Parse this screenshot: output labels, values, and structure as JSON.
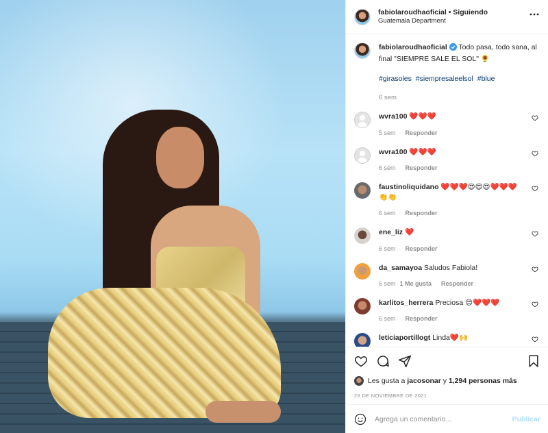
{
  "post": {
    "author": "fabiolaroudhaoficial",
    "follow_status": "Siguiendo",
    "separator": "•",
    "location": "Guatemala Department",
    "more_icon": "more-horizontal-icon"
  },
  "caption": {
    "author": "fabiolaroudhaoficial",
    "verified_icon": "verified-badge-icon",
    "text": "Todo pasa, todo sana, al final \"SIEMPRE SALE EL SOL\" 🌻",
    "hashtags": [
      "#girasoles",
      "#siempresaleelsol",
      "#blue"
    ],
    "time": "6 sem"
  },
  "comments": [
    {
      "user": "wvra100",
      "text": "❤️❤️❤️",
      "time": "5 sem",
      "reply": "Responder"
    },
    {
      "user": "wvra100",
      "text": "❤️❤️❤️",
      "time": "6 sem",
      "reply": "Responder"
    },
    {
      "user": "faustinoliquidano",
      "text": "❤️❤️❤️😍😍😍❤️❤️❤️👏👏",
      "time": "6 sem",
      "reply": "Responder"
    },
    {
      "user": "ene_liz",
      "text": "❤️",
      "time": "6 sem",
      "reply": "Responder"
    },
    {
      "user": "da_samayoa",
      "text": "Saludos Fabiola!",
      "time": "6 sem",
      "likes": "1 Me gusta",
      "reply": "Responder"
    },
    {
      "user": "karlitos_herrera",
      "text": "Preciosa 😍❤️❤️❤️",
      "time": "6 sem",
      "reply": "Responder"
    },
    {
      "user": "leticiaportillogt",
      "text": "Linda❤️🙌",
      "time": "",
      "reply": ""
    }
  ],
  "actions": {
    "like_icon": "heart-icon",
    "comment_icon": "comment-icon",
    "share_icon": "paper-plane-icon",
    "save_icon": "bookmark-icon"
  },
  "likes": {
    "prefix": "Les gusta a",
    "user": "jacosonar",
    "conjunction": "y",
    "count": "1,294 personas más"
  },
  "date": "23 DE NOVIEMBRE DE 2021",
  "add_comment": {
    "placeholder": "Agrega un comentario...",
    "publish": "Publicar",
    "emoji_icon": "emoji-icon"
  },
  "colors": {
    "link": "#00376b",
    "muted": "#8e8e8e",
    "publish_disabled": "#b2dffc",
    "heart": "#ed4956"
  }
}
